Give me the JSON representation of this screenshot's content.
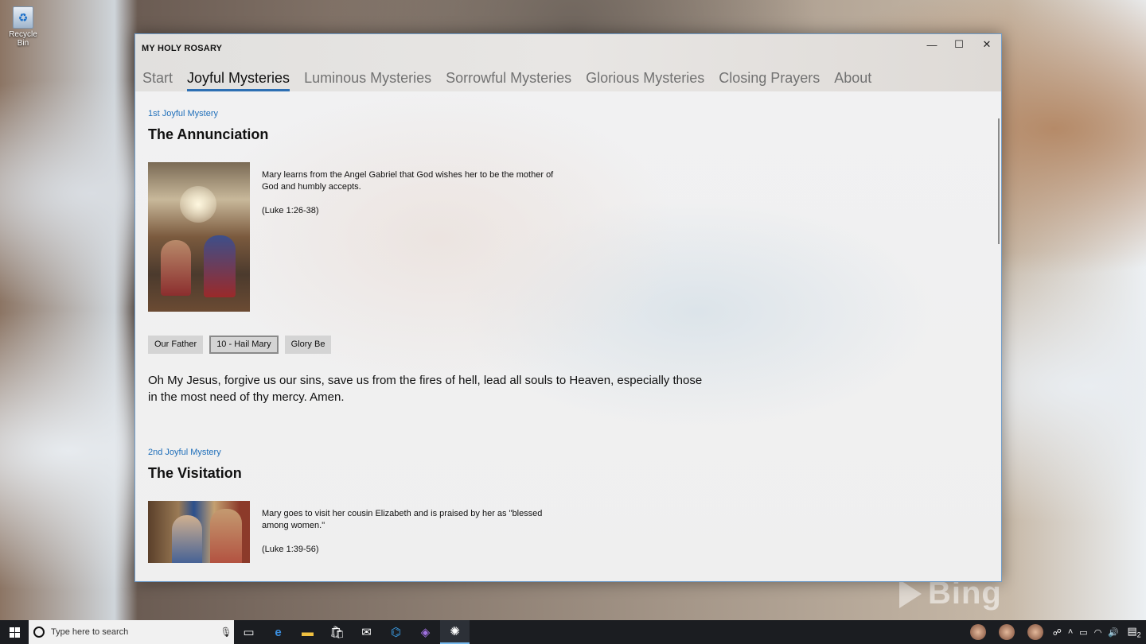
{
  "desktop": {
    "recycle_bin_label": "Recycle Bin",
    "bing_watermark": "Bing"
  },
  "window": {
    "title": "MY HOLY ROSARY",
    "controls": {
      "minimize": "—",
      "maximize": "☐",
      "close": "✕"
    },
    "tabs": [
      {
        "label": "Start"
      },
      {
        "label": "Joyful Mysteries"
      },
      {
        "label": "Luminous Mysteries"
      },
      {
        "label": "Sorrowful Mysteries"
      },
      {
        "label": "Glorious Mysteries"
      },
      {
        "label": "Closing Prayers"
      },
      {
        "label": "About"
      }
    ],
    "active_tab": "Joyful Mysteries",
    "accent_color": "#2d6fb3"
  },
  "mysteries": [
    {
      "number": "1st Joyful Mystery",
      "title": "The Annunciation",
      "description": "Mary learns from the Angel Gabriel that God wishes her to be the mother of God and humbly accepts.",
      "reference": "(Luke 1:26-38)",
      "buttons": [
        {
          "label": "Our Father"
        },
        {
          "label": "10 - Hail Mary"
        },
        {
          "label": "Glory Be"
        }
      ],
      "selected_button": "10 - Hail Mary",
      "prayer": "Oh My Jesus, forgive us our sins, save us from the fires of hell, lead all souls to Heaven, especially those in the most need of thy mercy. Amen."
    },
    {
      "number": "2nd Joyful Mystery",
      "title": "The Visitation",
      "description": "Mary goes to visit her cousin Elizabeth and is praised by her as \"blessed among women.\"",
      "reference": "(Luke 1:39-56)"
    }
  ],
  "taskbar": {
    "search_placeholder": "Type here to search",
    "apps": [
      "task-view-icon",
      "edge-icon",
      "file-explorer-icon",
      "store-icon",
      "mail-icon",
      "vscode-icon",
      "visual-studio-icon",
      "rosary-app-icon"
    ],
    "notification_count": "2"
  }
}
